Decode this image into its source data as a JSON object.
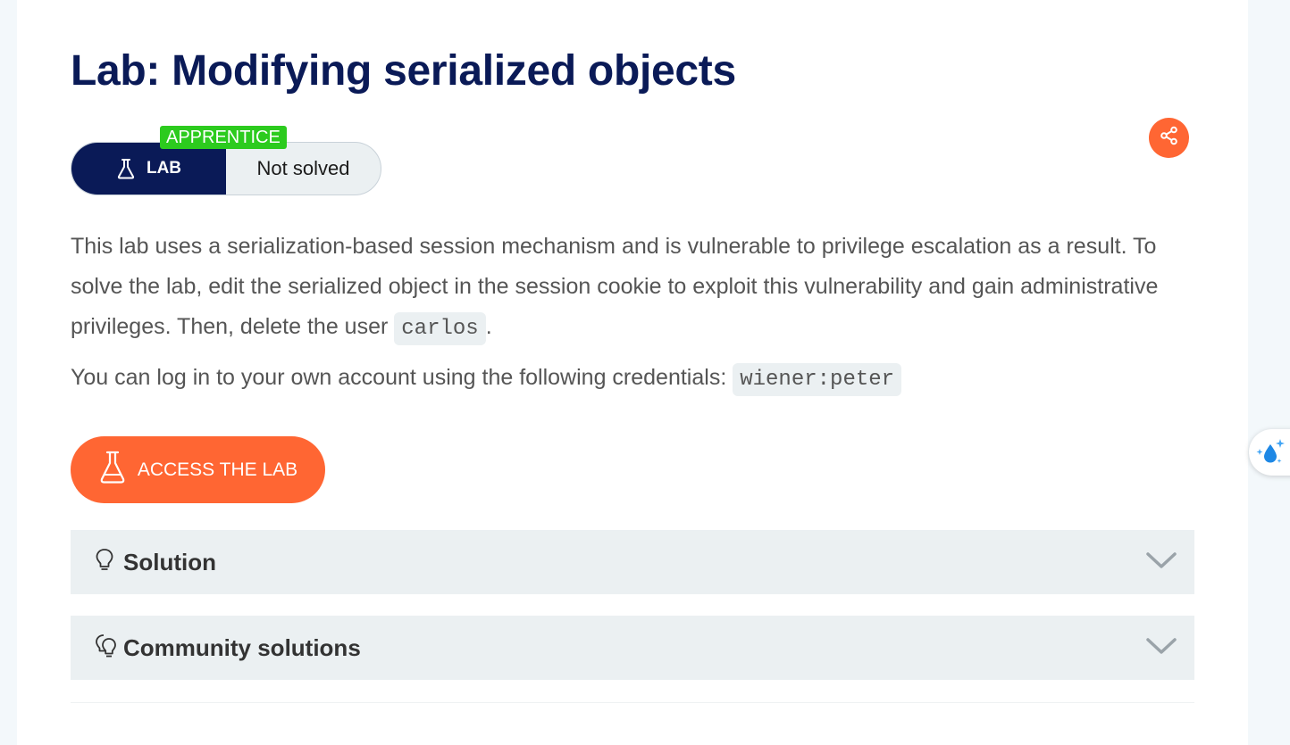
{
  "title": "Lab: Modifying serialized objects",
  "status": {
    "level": "APPRENTICE",
    "type": "LAB",
    "state": "Not solved"
  },
  "description": {
    "text_before": "This lab uses a serialization-based session mechanism and is vulnerable to privilege escalation as a result. To solve the lab, edit the serialized object in the session cookie to exploit this vulnerability and gain administrative privileges. Then, delete the user ",
    "code_user": "carlos",
    "text_after": "."
  },
  "credentials": {
    "text": "You can log in to your own account using the following credentials: ",
    "code": "wiener:peter"
  },
  "access_button": "ACCESS THE LAB",
  "accordions": [
    {
      "title": "Solution",
      "icon": "lightbulb-icon"
    },
    {
      "title": "Community solutions",
      "icon": "lightbulbs-icon"
    }
  ],
  "colors": {
    "title": "#0a1a57",
    "accent": "#ff6633",
    "badge": "#2ccb1e",
    "panel": "#ebf0f2"
  },
  "icons": {
    "share": "share-icon",
    "lab": "flask-icon",
    "chevron": "chevron-down-icon",
    "widget": "sparkle-droplet-icon"
  }
}
